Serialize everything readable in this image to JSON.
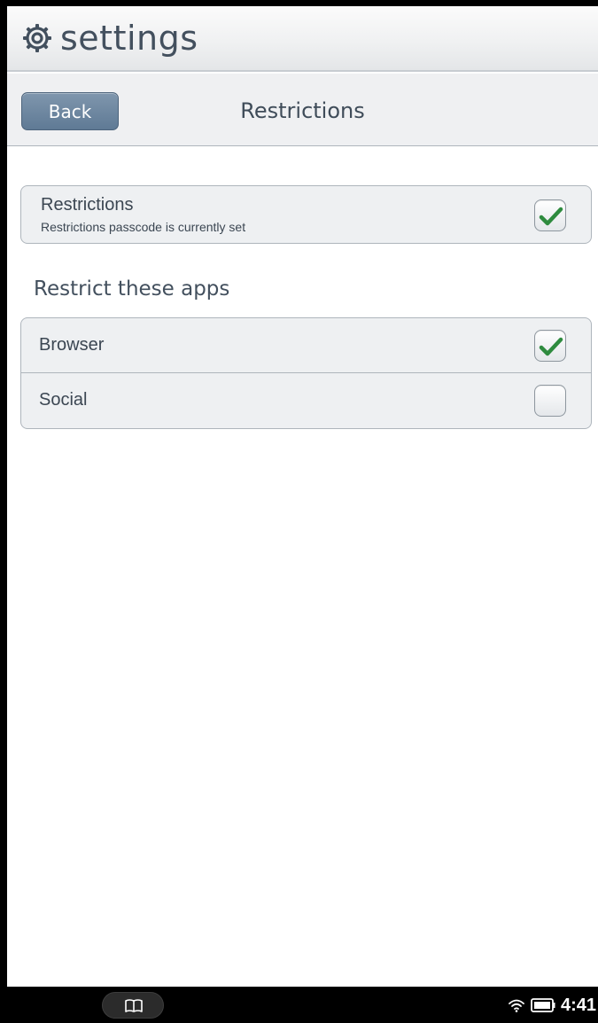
{
  "app": {
    "title": "settings",
    "icon": "gear-icon"
  },
  "nav": {
    "back_label": "Back",
    "title": "Restrictions"
  },
  "restrictions": {
    "title": "Restrictions",
    "subtitle": "Restrictions passcode is currently set",
    "checked": true
  },
  "section": {
    "heading": "Restrict these apps"
  },
  "apps": [
    {
      "label": "Browser",
      "checked": true
    },
    {
      "label": "Social",
      "checked": false
    }
  ],
  "system_bar": {
    "time": "4:41",
    "icons": [
      "library-icon",
      "wifi-icon",
      "battery-icon"
    ]
  },
  "colors": {
    "check_green": "#2e8b3e",
    "back_button": "#6b849e",
    "text": "#3b4652"
  }
}
